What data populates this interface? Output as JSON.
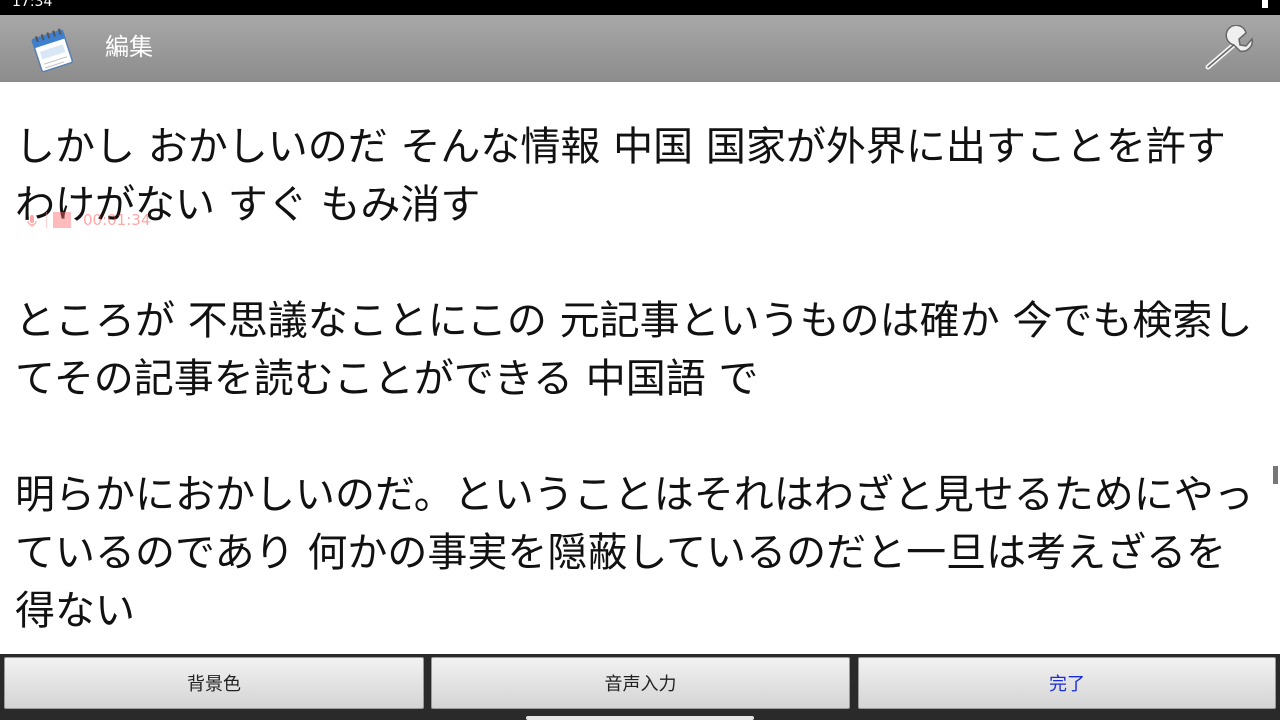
{
  "status_bar": {
    "time": "17:34"
  },
  "action_bar": {
    "title": "編集",
    "app_icon": "memo-calendar-icon",
    "settings_icon": "wrench-icon"
  },
  "editor": {
    "text": "しかし おかしいのだ そんな情報 中国 国家が外界に出すことを許すわけがない すぐ もみ消す\n\nところが 不思議なことにこの 元記事というものは確か 今でも検索してその記事を読むことができる 中国語 で\n\n明らかにおかしいのだ。ということはそれはわざと見せるためにやっているのであり 何かの事実を隠蔽しているのだと一旦は考えざるを得ない"
  },
  "recording": {
    "time": "00:01:34"
  },
  "buttons": {
    "background_color": "背景色",
    "voice_input": "音声入力",
    "done": "完了"
  },
  "colors": {
    "action_bar": "#999999",
    "done_text": "#1a2bd6",
    "recording": "#ff3b3b"
  }
}
